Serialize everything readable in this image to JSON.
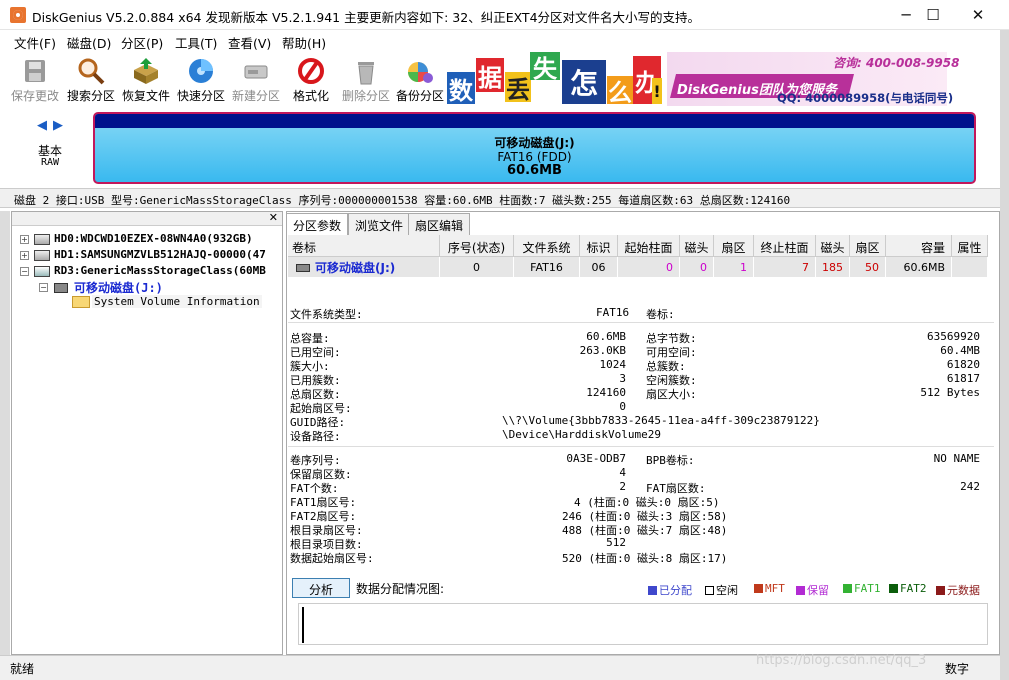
{
  "window": {
    "title": "DiskGenius V5.2.0.884 x64    发现新版本 V5.2.1.941 主要更新内容如下: 32、纠正EXT4分区对文件名大小写的支持。",
    "minimize": "─",
    "maximize": "☐",
    "close": "✕"
  },
  "menu": [
    "文件(F)",
    "磁盘(D)",
    "分区(P)",
    "工具(T)",
    "查看(V)",
    "帮助(H)"
  ],
  "toolbar": [
    {
      "label": "保存更改",
      "icon": "save-icon",
      "enabled": false
    },
    {
      "label": "搜索分区",
      "icon": "magnifier-icon",
      "enabled": true
    },
    {
      "label": "恢复文件",
      "icon": "recover-box-icon",
      "enabled": true
    },
    {
      "label": "快速分区",
      "icon": "quick-partition-icon",
      "enabled": true
    },
    {
      "label": "新建分区",
      "icon": "new-partition-icon",
      "enabled": false
    },
    {
      "label": "格式化",
      "icon": "format-icon",
      "enabled": true
    },
    {
      "label": "删除分区",
      "icon": "trash-icon",
      "enabled": false
    },
    {
      "label": "备份分区",
      "icon": "backup-icon",
      "enabled": true
    }
  ],
  "banner": {
    "tiles": [
      "数",
      "据",
      "丢",
      "失",
      "怎",
      "么",
      "办",
      "!"
    ],
    "slogan": "DiskGenius团队为您服务",
    "phone": "咨询: 400-008-9958",
    "qq": "QQ: 4000089958(与电话同号)"
  },
  "diskmap": {
    "nav_left": "◀",
    "nav_right": "▶",
    "mode": "基本",
    "type": "RAW",
    "part_name": "可移动磁盘(J:)",
    "part_fs": "FAT16 (FDD)",
    "part_size": "60.6MB"
  },
  "disk_info": "磁盘 2 接口:USB  型号:GenericMassStorageClass  序列号:000000001538  容量:60.6MB  柱面数:7  磁头数:255  每道扇区数:63  总扇区数:124160",
  "tree": {
    "nodes": [
      {
        "label": "HD0:WDCWD10EZEX-08WN4A0(932GB)",
        "expander": "+"
      },
      {
        "label": "HD1:SAMSUNGMZVLB512HAJQ-00000(47",
        "expander": "+"
      },
      {
        "label": "RD3:GenericMassStorageClass(60MB",
        "expander": "−"
      },
      {
        "label": "可移动磁盘(J:)",
        "expander": "−"
      },
      {
        "label": "System Volume Information",
        "expander": ""
      }
    ]
  },
  "tabs": [
    "分区参数",
    "浏览文件",
    "扇区编辑"
  ],
  "partition_table": {
    "headers": [
      "卷标",
      "序号(状态)",
      "文件系统",
      "标识",
      "起始柱面",
      "磁头",
      "扇区",
      "终止柱面",
      "磁头",
      "扇区",
      "容量",
      "属性"
    ],
    "rows": [
      [
        "可移动磁盘(J:)",
        "0",
        "FAT16",
        "06",
        "0",
        "0",
        "1",
        "7",
        "185",
        "50",
        "60.6MB",
        ""
      ]
    ]
  },
  "details": {
    "fs_type_label": "文件系统类型:",
    "fs_type": "FAT16",
    "vol_label_label": "卷标:",
    "vol_label": "",
    "left_rows": [
      {
        "k": "总容量:",
        "v": "60.6MB"
      },
      {
        "k": "已用空间:",
        "v": "263.0KB"
      },
      {
        "k": "簇大小:",
        "v": "1024"
      },
      {
        "k": "已用簇数:",
        "v": "3"
      },
      {
        "k": "总扇区数:",
        "v": "124160"
      },
      {
        "k": "起始扇区号:",
        "v": "0"
      }
    ],
    "right_rows": [
      {
        "k": "总字节数:",
        "v": "63569920"
      },
      {
        "k": "可用空间:",
        "v": "60.4MB"
      },
      {
        "k": "总簇数:",
        "v": "61820"
      },
      {
        "k": "空闲簇数:",
        "v": "61817"
      },
      {
        "k": "扇区大小:",
        "v": "512 Bytes"
      }
    ],
    "guid_label": "GUID路径:",
    "guid": "\\\\?\\Volume{3bbb7833-2645-11ea-a4ff-309c23879122}",
    "dev_label": "设备路径:",
    "dev": "\\Device\\HarddiskVolume29",
    "serial_label": "卷序列号:",
    "serial": "0A3E-ODB7",
    "bpb_label": "BPB卷标:",
    "bpb": "NO NAME",
    "reserved_label": "保留扇区数:",
    "reserved": "4",
    "fat_count_label": "FAT个数:",
    "fat_count": "2",
    "fat_sectors_label": "FAT扇区数:",
    "fat_sectors": "242",
    "fat1_label": "FAT1扇区号:",
    "fat1": "4 (柱面:0 磁头:0 扇区:5)",
    "fat2_label": "FAT2扇区号:",
    "fat2": "246 (柱面:0 磁头:3 扇区:58)",
    "root_label": "根目录扇区号:",
    "root": "488 (柱面:0 磁头:7 扇区:48)",
    "root_entries_label": "根目录项目数:",
    "root_entries": "512",
    "data_start_label": "数据起始扇区号:",
    "data_start": "520 (柱面:0 磁头:8 扇区:17)"
  },
  "analyze": {
    "button": "分析",
    "label": "数据分配情况图:",
    "legend": [
      {
        "label": "已分配",
        "color": "#3f48cc"
      },
      {
        "label": "空闲",
        "color": "#ffffff"
      },
      {
        "label": "MFT",
        "color": "#c0391b"
      },
      {
        "label": "保留",
        "color": "#b22bd3"
      },
      {
        "label": "FAT1",
        "color": "#33b233"
      },
      {
        "label": "FAT2",
        "color": "#0b5d0b"
      },
      {
        "label": "元数据",
        "color": "#8b1a1a"
      }
    ]
  },
  "status": {
    "left": "就绪",
    "right": "数字"
  },
  "watermark": "https://blog.csdn.net/qq_3"
}
